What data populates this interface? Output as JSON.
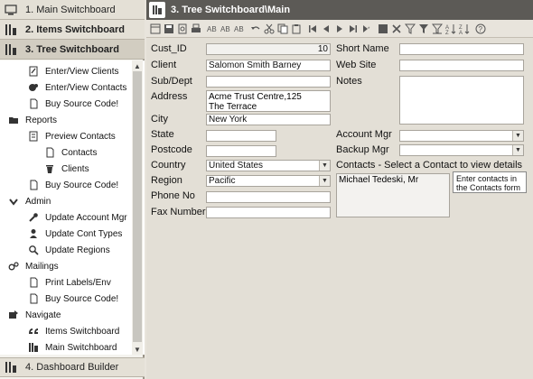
{
  "sidebar": {
    "sections": [
      {
        "label": "1. Main Switchboard",
        "icon": "monitor-icon"
      },
      {
        "label": "2. Items Switchboard",
        "icon": "stack-icon"
      },
      {
        "label": "3. Tree Switchboard",
        "icon": "tree-stack-icon"
      },
      {
        "label": "4. Dashboard Builder",
        "icon": "stack-icon"
      }
    ],
    "tree": [
      {
        "label": "Enter/View Clients",
        "level": 1,
        "icon": "edit-doc-icon"
      },
      {
        "label": "Enter/View Contacts",
        "level": 1,
        "icon": "contacts-icon"
      },
      {
        "label": "Buy  Source Code!",
        "level": 1,
        "icon": "doc-icon"
      },
      {
        "label": "Reports",
        "level": 0,
        "icon": "folder-icon"
      },
      {
        "label": "Preview Contacts",
        "level": 1,
        "icon": "preview-icon"
      },
      {
        "label": "Contacts",
        "level": 2,
        "icon": "doc-icon"
      },
      {
        "label": "Clients",
        "level": 2,
        "icon": "trash-icon"
      },
      {
        "label": "Buy Source Code!",
        "level": 1,
        "icon": "doc-icon"
      },
      {
        "label": "Admin",
        "level": 0,
        "icon": "check-icon"
      },
      {
        "label": "Update Account Mgr",
        "level": 1,
        "icon": "wrench-icon"
      },
      {
        "label": "Update  Cont Types",
        "level": 1,
        "icon": "person-icon"
      },
      {
        "label": "Update Regions",
        "level": 1,
        "icon": "search-icon"
      },
      {
        "label": "Mailings",
        "level": 0,
        "icon": "gears-icon"
      },
      {
        "label": "Print Labels/Env",
        "level": 1,
        "icon": "doc-icon"
      },
      {
        "label": "Buy Source Code!",
        "level": 1,
        "icon": "doc-icon"
      },
      {
        "label": "Navigate",
        "level": 0,
        "icon": "navigate-icon"
      },
      {
        "label": "Items Switchboard",
        "level": 1,
        "icon": "quote-icon"
      },
      {
        "label": "Main Switchboard",
        "level": 1,
        "icon": "stack-icon"
      }
    ]
  },
  "form": {
    "title": "3. Tree Switchboard\\Main",
    "labels": {
      "cust_id": "Cust_ID",
      "client": "Client",
      "sub_dept": "Sub/Dept",
      "address": "Address",
      "city": "City",
      "state": "State",
      "postcode": "Postcode",
      "country": "Country",
      "region": "Region",
      "phone": "Phone No",
      "fax": "Fax Number",
      "short_name": "Short Name",
      "web_site": "Web Site",
      "notes": "Notes",
      "account_mgr": "Account Mgr",
      "backup_mgr": "Backup Mgr",
      "contacts": "Contacts - Select a Contact to view details"
    },
    "values": {
      "cust_id": "10",
      "client": "Salomon Smith Barney",
      "sub_dept": "",
      "address_line1": "Acme Trust Centre,125",
      "address_line2": "The Terrace",
      "city": "New York",
      "state": "",
      "postcode": "",
      "country": "United States",
      "region": "Pacific",
      "phone": "",
      "fax": "",
      "short_name": "",
      "web_site": "",
      "notes": "",
      "account_mgr": "",
      "backup_mgr": "",
      "contact_item": "Michael Tedeski, Mr"
    },
    "tooltip_line1": "Enter contacts in",
    "tooltip_line2": "the Contacts form"
  },
  "toolbar_icons": [
    "design-view-icon",
    "save-icon",
    "print-preview-icon",
    "print-icon",
    "spelling-icon",
    "find-icon",
    "find-replace-icon",
    "undo-icon",
    "cut-icon",
    "copy-icon",
    "paste-icon",
    "first-record-icon",
    "previous-record-icon",
    "next-record-icon",
    "last-record-icon",
    "new-record-icon",
    "save-record-icon",
    "delete-record-icon",
    "filter-by-selection-icon",
    "filter-by-form-icon",
    "apply-filter-icon",
    "sort-ascending-icon",
    "sort-descending-icon",
    "help-icon"
  ]
}
